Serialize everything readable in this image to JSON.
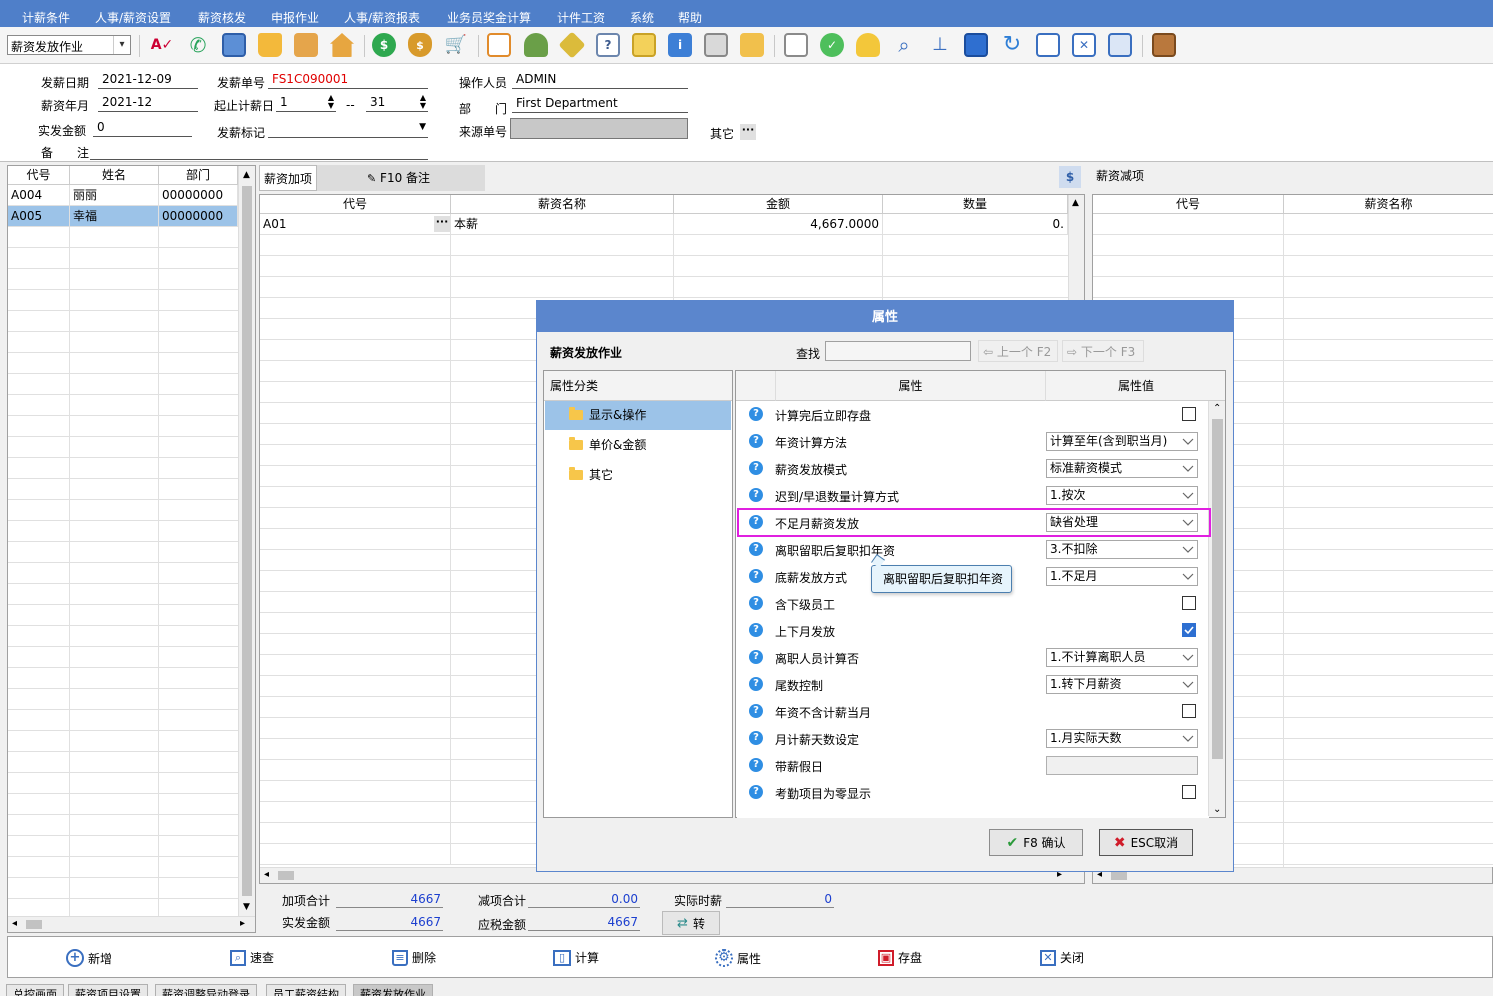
{
  "menu": [
    "计薪条件",
    "人事/薪资设置",
    "薪资核发",
    "申报作业",
    "人事/薪资报表",
    "业务员奖金计算",
    "计件工资",
    "系统",
    "帮助"
  ],
  "toolbar": {
    "combo_value": "薪资发放作业"
  },
  "form": {
    "pay_date_label": "发薪日期",
    "pay_date": "2021-12-09",
    "pay_no_label": "发薪单号",
    "pay_no": "FS1C090001",
    "operator_label": "操作人员",
    "operator": "ADMIN",
    "pay_month_label": "薪资年月",
    "pay_month": "2021-12",
    "range_label": "起止计薪日",
    "range_start": "1",
    "range_sep": "--",
    "range_end": "31",
    "dept_label": "部　　门",
    "dept": "First Department",
    "actual_label": "实发金额",
    "actual": "0",
    "flag_label": "发薪标记",
    "source_label": "来源单号",
    "other_label": "其它",
    "note_label": "备　　注"
  },
  "emp_grid": {
    "headers": [
      "代号",
      "姓名",
      "部门"
    ],
    "rows": [
      [
        "A004",
        "丽丽",
        "00000000"
      ],
      [
        "A005",
        "幸福",
        "00000000"
      ]
    ]
  },
  "add_panel": {
    "tab1": "薪资加项",
    "tab2": "F10 备注",
    "headers": [
      "代号",
      "薪资名称",
      "金额",
      "数量"
    ],
    "rows": [
      [
        "A01",
        "本薪",
        "4,667.0000",
        "0."
      ]
    ]
  },
  "sub_panel": {
    "tab": "薪资减项",
    "headers": [
      "代号",
      "薪资名称"
    ]
  },
  "totals": {
    "add_total_label": "加项合计",
    "add_total": "4667",
    "sub_total_label": "减项合计",
    "sub_total": "0.00",
    "actual_days_label": "实际时薪",
    "actual_days": "0",
    "net_label": "实发金额",
    "net": "4667",
    "taxable_label": "应税金额",
    "taxable": "4667",
    "transfer_label": "转"
  },
  "bottom_buttons": [
    "新增",
    "速查",
    "删除",
    "计算",
    "属性",
    "存盘",
    "关闭"
  ],
  "window_tabs": [
    "总控画面",
    "薪资项目设置",
    "薪资调整异动登录",
    "员工薪资结构",
    "薪资发放作业"
  ],
  "dialog": {
    "title": "属性",
    "subtitle": "薪资发放作业",
    "search_label": "查找",
    "prev_label": "上一个 F2",
    "next_label": "下一个 F3",
    "category_header": "属性分类",
    "categories": [
      "显示&操作",
      "单价&金额",
      "其它"
    ],
    "prop_header": "属性",
    "value_header": "属性值",
    "properties": [
      {
        "name": "计算完后立即存盘",
        "type": "check",
        "value": false
      },
      {
        "name": "年资计算方法",
        "type": "combo",
        "value": "计算至年(含到职当月)"
      },
      {
        "name": "薪资发放模式",
        "type": "combo",
        "value": "标准薪资模式"
      },
      {
        "name": "迟到/早退数量计算方式",
        "type": "combo",
        "value": "1.按次"
      },
      {
        "name": "不足月薪资发放",
        "type": "combo",
        "value": "缺省处理"
      },
      {
        "name": "离职留职后复职扣年资",
        "type": "combo",
        "value": "3.不扣除"
      },
      {
        "name": "底薪发放方式",
        "type": "combo",
        "value": "1.不足月"
      },
      {
        "name": "含下级员工",
        "type": "check",
        "value": false
      },
      {
        "name": "上下月发放",
        "type": "check",
        "value": true
      },
      {
        "name": "离职人员计算否",
        "type": "combo",
        "value": "1.不计算离职人员"
      },
      {
        "name": "尾数控制",
        "type": "combo",
        "value": "1.转下月薪资"
      },
      {
        "name": "年资不含计薪当月",
        "type": "check",
        "value": false
      },
      {
        "name": "月计薪天数设定",
        "type": "combo",
        "value": "1.月实际天数"
      },
      {
        "name": "带薪假日",
        "type": "field",
        "value": ""
      },
      {
        "name": "考勤项目为零显示",
        "type": "check",
        "value": false
      }
    ],
    "tooltip": "离职留职后复职扣年资",
    "ok_label": "F8 确认",
    "cancel_label": "ESC取消",
    "highlight_color": "#e020e0"
  }
}
